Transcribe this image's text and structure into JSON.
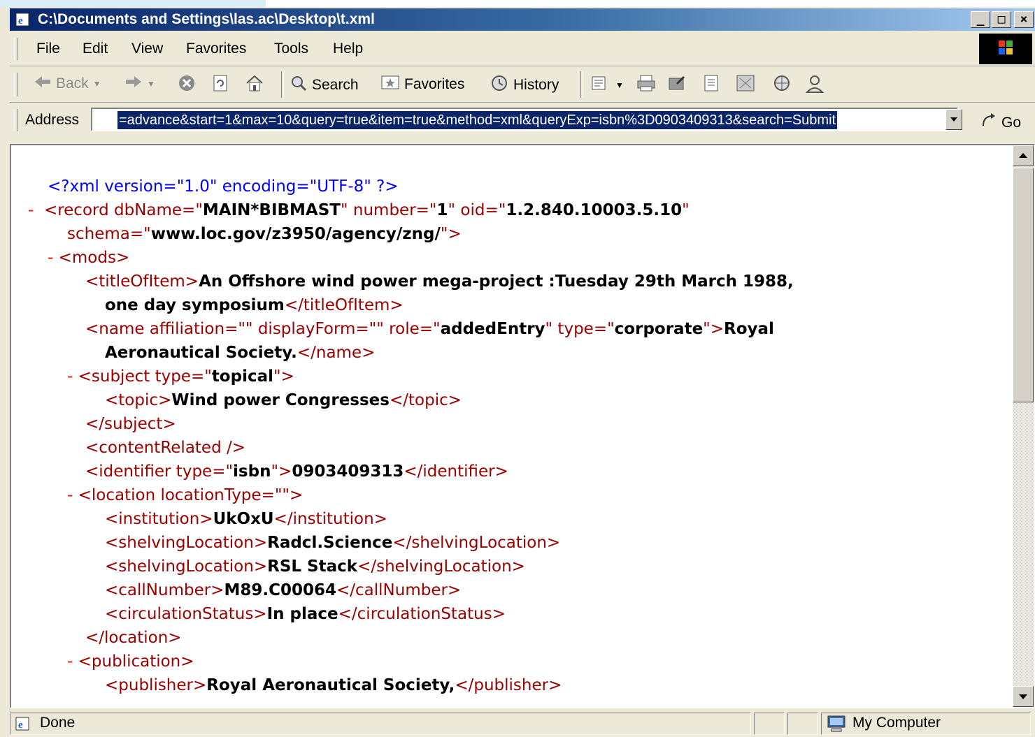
{
  "window": {
    "title": "C:\\Documents and Settings\\las.ac\\Desktop\\t.xml",
    "minimize": "_",
    "maximize": "□",
    "close": "×"
  },
  "menu": {
    "file": "File",
    "edit": "Edit",
    "view": "View",
    "favorites": "Favorites",
    "tools": "Tools",
    "help": "Help"
  },
  "toolbar": {
    "back": "Back",
    "search": "Search",
    "favorites": "Favorites",
    "history": "History"
  },
  "address": {
    "label": "Address",
    "value": "=advance&start=1&max=10&query=true&item=true&method=xml&queryExp=isbn%3D0903409313&search=Submit",
    "go": "Go"
  },
  "xml": {
    "pi": "<?xml version=\"1.0\" encoding=\"UTF-8\" ?>",
    "minus": "-",
    "record": {
      "open": "<record",
      "dbName_attr": " dbName=\"",
      "dbName_val": "MAIN*BIBMAST",
      "number_attr": "\" number=\"",
      "number_val": "1",
      "oid_attr": "\" oid=\"",
      "oid_val": "1.2.840.10003.5.10",
      "close_q": "\"",
      "schema_attr": "schema=\"",
      "schema_val": "www.loc.gov/z3950/agency/zng/",
      "schema_end": "\">"
    },
    "mods_open": "<mods>",
    "titleOfItem": {
      "open": "<titleOfItem>",
      "text1": "An Offshore wind power mega-project :Tuesday 29th March 1988,",
      "text2": "one day symposium",
      "close": "</titleOfItem>"
    },
    "name": {
      "open": "<name",
      "affiliation": " affiliation=\"\"",
      "displayForm": " displayForm=\"\"",
      "role_attr": " role=\"",
      "role_val": "addedEntry",
      "type_attr": "\" type=\"",
      "type_val": "corporate",
      "gt": "\">",
      "text1": "Royal",
      "text2": "Aeronautical Society.",
      "close": "</name>"
    },
    "subject": {
      "open": "<subject",
      "type_attr": " type=\"",
      "type_val": "topical",
      "gt": "\">",
      "topic_open": "<topic>",
      "topic_text": "Wind power Congresses",
      "topic_close": "</topic>",
      "close": "</subject>"
    },
    "contentRelated": "<contentRelated />",
    "identifier": {
      "open": "<identifier",
      "type_attr": " type=\"",
      "type_val": "isbn",
      "gt": "\">",
      "text": "0903409313",
      "close": "</identifier>"
    },
    "location": {
      "open": "<location",
      "attr": " locationType=\"\">",
      "institution_open": "<institution>",
      "institution_text": "UkOxU",
      "institution_close": "</institution>",
      "shelving1_open": "<shelvingLocation>",
      "shelving1_text": "Radcl.Science",
      "shelving1_close": "</shelvingLocation>",
      "shelving2_open": "<shelvingLocation>",
      "shelving2_text": "RSL Stack",
      "shelving2_close": "</shelvingLocation>",
      "callNumber_open": "<callNumber>",
      "callNumber_text": "M89.C00064",
      "callNumber_close": "</callNumber>",
      "circ_open": "<circulationStatus>",
      "circ_text": "In place",
      "circ_close": "</circulationStatus>",
      "close": "</location>"
    },
    "publication": {
      "open": "<publication>",
      "publisher_open": "<publisher>",
      "publisher_text": "Royal Aeronautical Society,",
      "publisher_close": "</publisher>"
    }
  },
  "status": {
    "text": "Done",
    "zone": "My Computer"
  },
  "colors": {
    "title_gradient_start": "#0a246a",
    "title_gradient_end": "#a6caf0",
    "xml_tag": "#990000",
    "xml_pi": "#0000ff",
    "xml_minus": "#ff0000",
    "chrome": "#ece9d8"
  }
}
